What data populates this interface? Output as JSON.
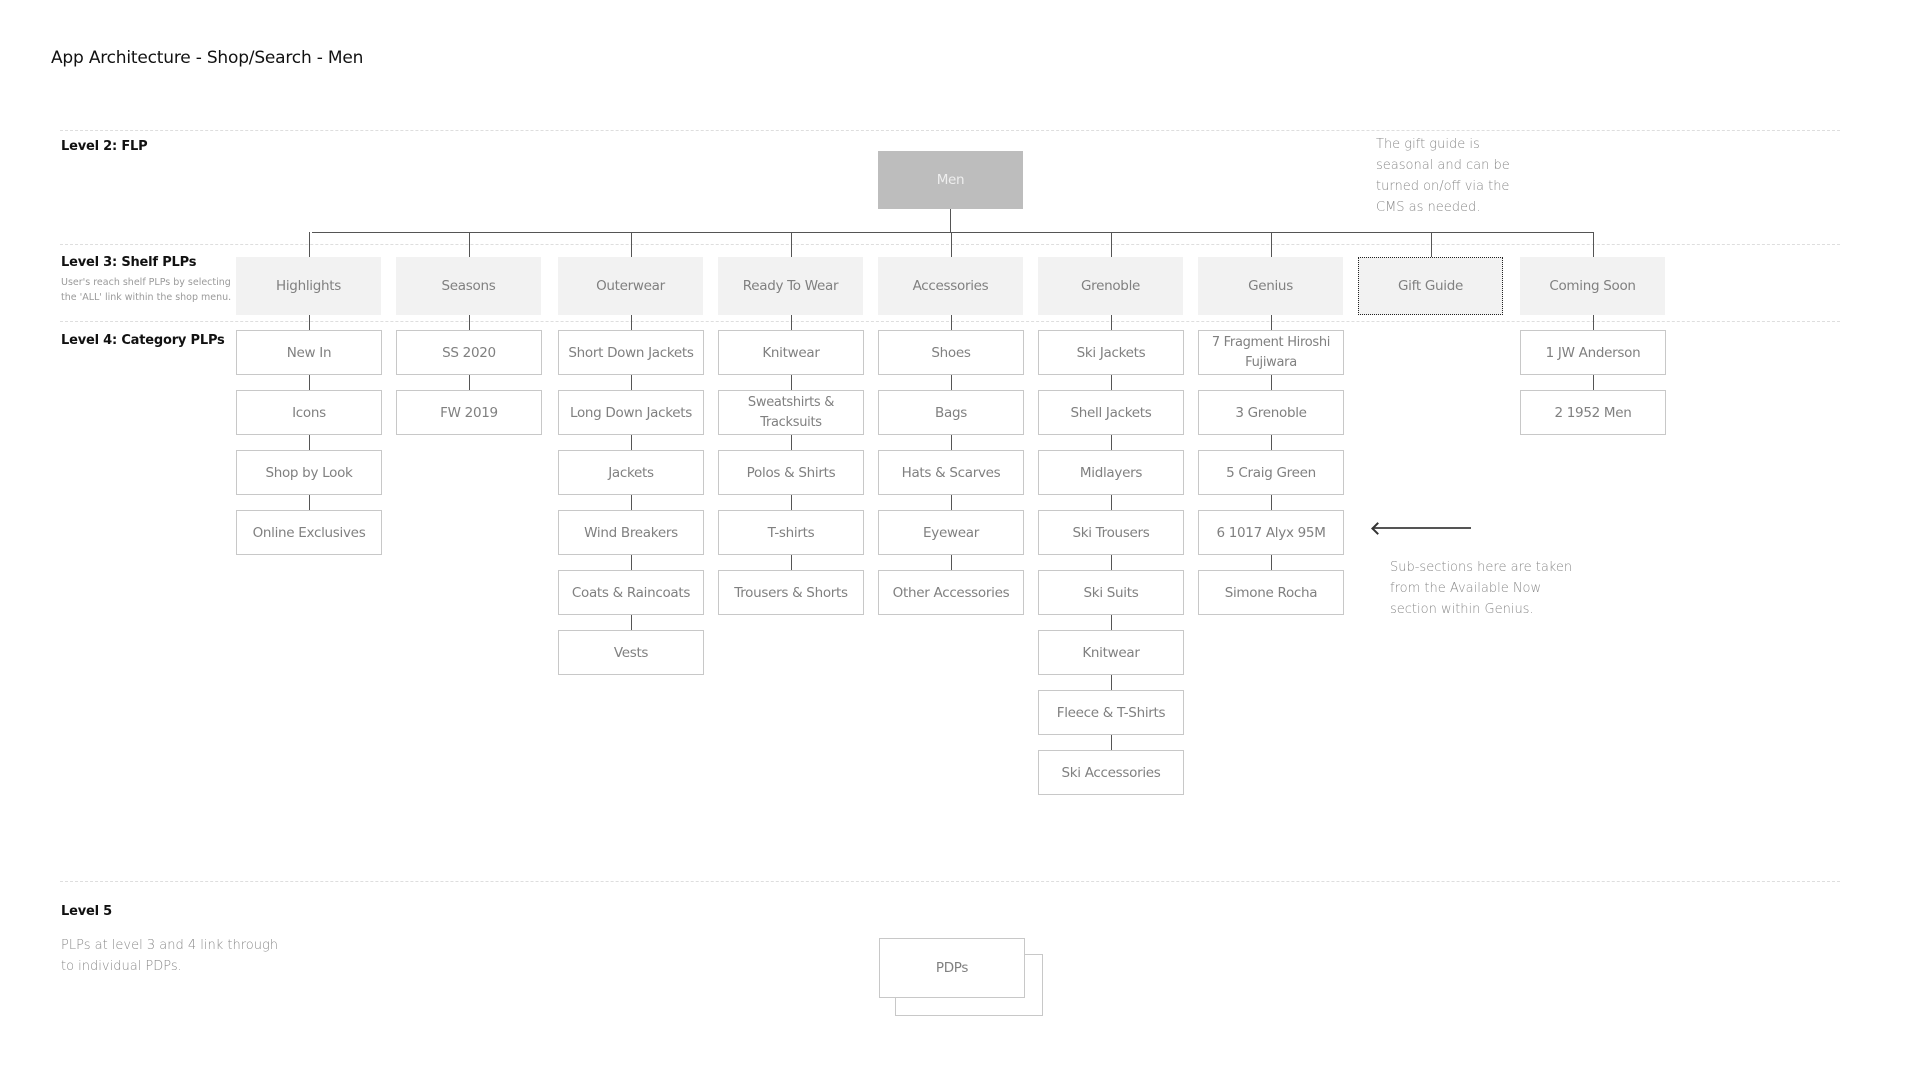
{
  "title": "App Architecture - Shop/Search - Men",
  "levels": {
    "level2": {
      "label": "Level 2: FLP"
    },
    "level3": {
      "label": "Level 3: Shelf PLPs",
      "description": "User's reach shelf PLPs by selecting the 'ALL' link within the shop menu."
    },
    "level4": {
      "label": "Level 4: Category PLPs"
    },
    "level5": {
      "label": "Level 5",
      "description": "PLPs at level 3 and 4 link through to individual PDPs."
    }
  },
  "root": {
    "label": "Men"
  },
  "shelves": [
    {
      "label": "Highlights",
      "categories": [
        "New In",
        "Icons",
        "Shop by Look",
        "Online Exclusives"
      ]
    },
    {
      "label": "Seasons",
      "categories": [
        "SS 2020",
        "FW 2019"
      ]
    },
    {
      "label": "Outerwear",
      "categories": [
        "Short Down Jackets",
        "Long Down Jackets",
        "Jackets",
        "Wind Breakers",
        "Coats & Raincoats",
        "Vests"
      ]
    },
    {
      "label": "Ready To Wear",
      "categories": [
        "Knitwear",
        "Sweatshirts & Tracksuits",
        "Polos & Shirts",
        "T-shirts",
        "Trousers & Shorts"
      ]
    },
    {
      "label": "Accessories",
      "categories": [
        "Shoes",
        "Bags",
        "Hats & Scarves",
        "Eyewear",
        "Other Accessories"
      ]
    },
    {
      "label": "Grenoble",
      "categories": [
        "Ski Jackets",
        "Shell Jackets",
        "Midlayers",
        "Ski Trousers",
        "Ski Suits",
        "Knitwear",
        "Fleece & T-Shirts",
        "Ski Accessories"
      ]
    },
    {
      "label": "Genius",
      "categories": [
        "7 Fragment Hiroshi Fujiwara",
        "3 Grenoble",
        "5 Craig Green",
        "6 1017 Alyx 95M",
        "Simone Rocha"
      ]
    },
    {
      "label": "Gift Guide",
      "optional": true,
      "categories": []
    },
    {
      "label": "Coming Soon",
      "categories": [
        "1 JW Anderson",
        "2 1952 Men"
      ]
    }
  ],
  "notes": {
    "gift_guide": "The gift guide is seasonal and can be turned on/off via the CMS as needed.",
    "genius": "Sub-sections here are taken from the Available Now section within Genius."
  },
  "pdp": {
    "label": "PDPs"
  },
  "colors": {
    "root_fill": "#bdbdbd",
    "shelf_fill": "#f2f2f2",
    "box_border": "#c8c8c8",
    "connector": "#555555"
  }
}
